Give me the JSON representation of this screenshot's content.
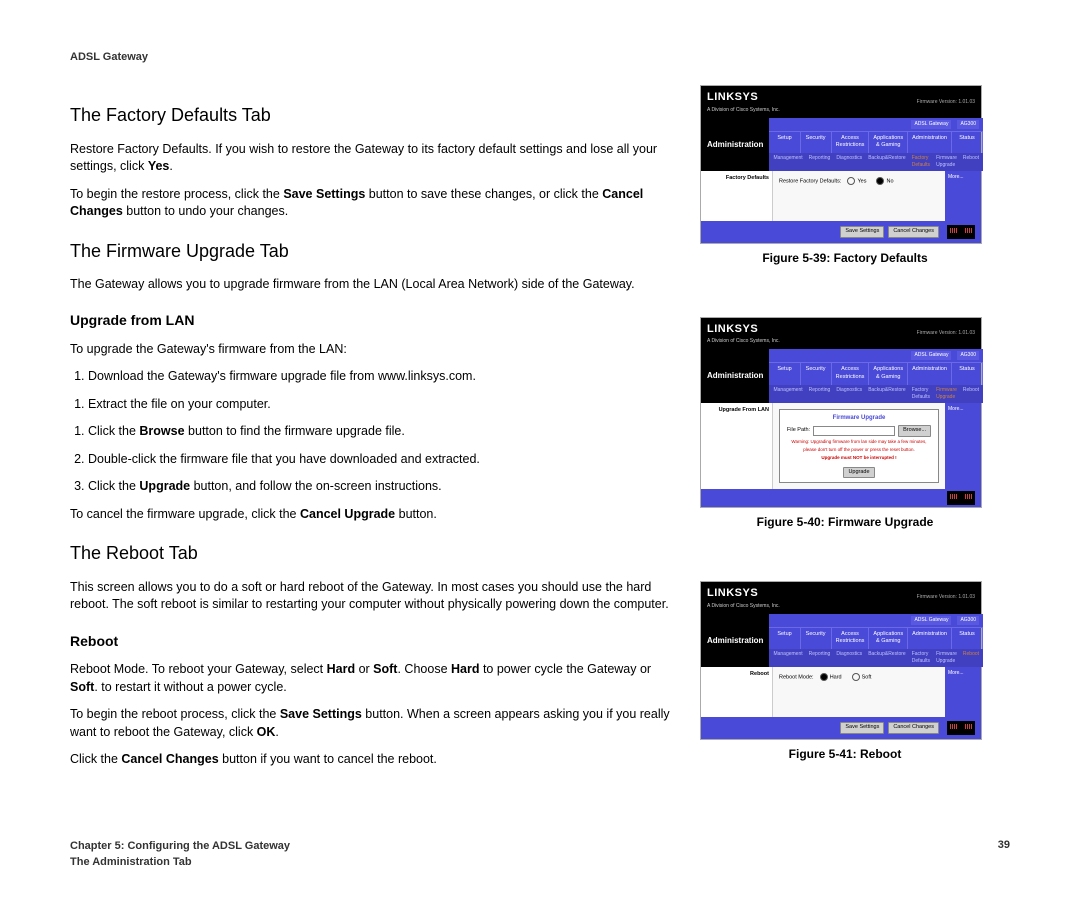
{
  "header": {
    "title": "ADSL Gateway"
  },
  "sections": {
    "factory": {
      "title": "The Factory Defaults Tab",
      "p1_a": "Restore Factory Defaults. If you wish to restore the Gateway to its factory default settings and lose all your settings, click ",
      "p1_b": "Yes",
      "p1_c": ".",
      "p2_a": "To begin the restore process, click the ",
      "p2_b": "Save Settings",
      "p2_c": " button to save these changes, or click the ",
      "p2_d": "Cancel Changes",
      "p2_e": " button to undo your changes."
    },
    "firmware": {
      "title": "The Firmware Upgrade Tab",
      "intro": "The Gateway allows you to upgrade firmware from the LAN (Local Area Network) side of the Gateway.",
      "sub": "Upgrade from LAN",
      "lead": "To upgrade the Gateway's firmware from the LAN:",
      "s1": "Download the Gateway's firmware upgrade file from www.linksys.com.",
      "s2": "Extract the file on your computer.",
      "s3_a": "Click the ",
      "s3_b": "Browse",
      "s3_c": " button to find the firmware upgrade file.",
      "s4": "Double-click the firmware file that you have downloaded and extracted.",
      "s5_a": "Click the ",
      "s5_b": "Upgrade",
      "s5_c": " button, and follow the on-screen instructions.",
      "cancel_a": "To cancel the firmware upgrade, click the ",
      "cancel_b": "Cancel Upgrade",
      "cancel_c": " button."
    },
    "reboot": {
      "title": "The Reboot Tab",
      "intro": "This screen allows you to do a soft or hard reboot of the Gateway. In most cases you should use the hard reboot. The soft reboot is similar to restarting your computer without physically powering down the computer.",
      "sub": "Reboot",
      "p1_a": "Reboot Mode. To reboot your Gateway, select ",
      "p1_b": "Hard",
      "p1_c": " or ",
      "p1_d": "Soft",
      "p1_e": ". Choose ",
      "p1_f": "Hard",
      "p1_g": " to power cycle the Gateway or ",
      "p1_h": "Soft",
      "p1_i": ". to restart it without a power cycle.",
      "p2_a": "To begin the reboot process, click the ",
      "p2_b": "Save Settings",
      "p2_c": " button. When a screen appears asking you if you really want to reboot the Gateway, click ",
      "p2_d": "OK",
      "p2_e": ".",
      "p3_a": "Click the ",
      "p3_b": "Cancel Changes",
      "p3_c": " button if you want to cancel the reboot."
    }
  },
  "figures": {
    "f39": {
      "caption": "Figure 5-39: Factory Defaults"
    },
    "f40": {
      "caption": "Figure 5-40: Firmware Upgrade"
    },
    "f41": {
      "caption": "Figure 5-41: Reboot"
    }
  },
  "shot": {
    "logo": "LINKSYS",
    "logo_sub": "A Division of Cisco Systems, Inc.",
    "fw_version": "Firmware Version: 1.01.03",
    "model_label": "ADSL Gateway",
    "model_num": "AG300",
    "admin": "Administration",
    "tabs": [
      "Setup",
      "Security",
      "Access Restrictions",
      "Applications & Gaming",
      "Administration",
      "Status"
    ],
    "subtabs": [
      "Management",
      "Reporting",
      "Diagnostics",
      "Backup&Restore",
      "Factory Defaults",
      "Firmware Upgrade",
      "Reboot"
    ],
    "more": "More...",
    "save": "Save Settings",
    "cancel": "Cancel Changes",
    "fd_label": "Factory Defaults",
    "fd_text": "Restore Factory Defaults:",
    "yes": "Yes",
    "no": "No",
    "fw_label": "Upgrade From LAN",
    "fw_title": "Firmware Upgrade",
    "fw_filepath": "File Path:",
    "fw_browse": "Browse...",
    "fw_warn1": "Warning: Upgrading firmware from lan side may take a few minutes,",
    "fw_warn2": "please don't turn off the power or press the reset button.",
    "fw_warn3": "Upgrade must NOT be interrupted !",
    "fw_upgrade": "Upgrade",
    "rb_label": "Reboot",
    "rb_mode": "Reboot Mode:",
    "rb_hard": "Hard",
    "rb_soft": "Soft"
  },
  "footer": {
    "chapter": "Chapter 5: Configuring the ADSL Gateway",
    "section": "The Administration Tab",
    "page": "39"
  }
}
